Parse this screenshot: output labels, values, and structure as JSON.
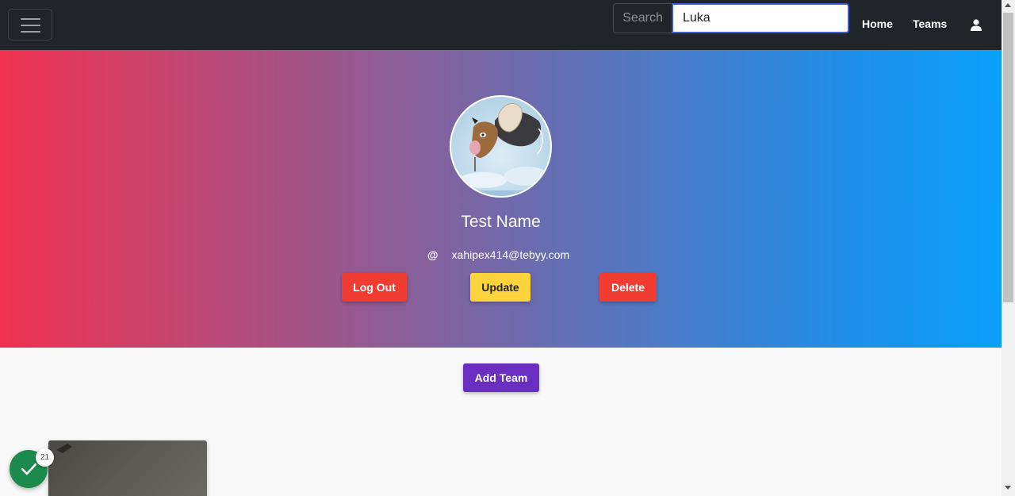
{
  "navbar": {
    "search": {
      "addon_label": "Search",
      "value": "Luka"
    },
    "links": [
      {
        "label": "Home"
      },
      {
        "label": "Teams"
      }
    ],
    "user_icon": "user-icon",
    "background": "#212529"
  },
  "profile": {
    "name": "Test Name",
    "email": "xahipex414@tebyy.com",
    "email_icon": "@",
    "buttons": {
      "logout": "Log Out",
      "update": "Update",
      "delete": "Delete"
    },
    "colors": {
      "danger": "#f13c32",
      "warning": "#fed33c"
    }
  },
  "main": {
    "add_team_label": "Add Team",
    "add_team_color": "#6a2fc0"
  },
  "status": {
    "icon": "check-icon",
    "count": "21",
    "color": "#1b8a4c"
  }
}
